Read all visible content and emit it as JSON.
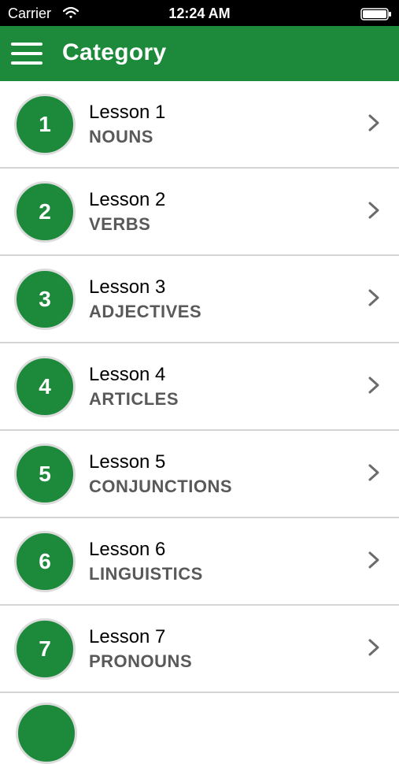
{
  "status_bar": {
    "carrier": "Carrier",
    "time": "12:24 AM",
    "wifi_icon": "wifi-icon",
    "battery_icon": "battery-icon"
  },
  "app_bar": {
    "title": "Category",
    "menu_icon": "hamburger-menu-icon",
    "color": "#1d8a3b"
  },
  "lessons": [
    {
      "number": "1",
      "title": "Lesson 1",
      "subtitle": "NOUNS"
    },
    {
      "number": "2",
      "title": "Lesson 2",
      "subtitle": "VERBS"
    },
    {
      "number": "3",
      "title": "Lesson 3",
      "subtitle": "ADJECTIVES"
    },
    {
      "number": "4",
      "title": "Lesson 4",
      "subtitle": "ARTICLES"
    },
    {
      "number": "5",
      "title": "Lesson 5",
      "subtitle": "CONJUNCTIONS"
    },
    {
      "number": "6",
      "title": "Lesson 6",
      "subtitle": "LINGUISTICS"
    },
    {
      "number": "7",
      "title": "Lesson 7",
      "subtitle": "PRONOUNS"
    }
  ],
  "row_icon": "chevron-right-icon"
}
